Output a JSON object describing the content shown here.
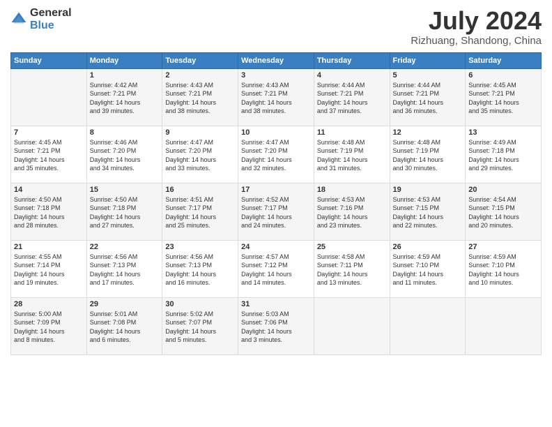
{
  "logo": {
    "general": "General",
    "blue": "Blue"
  },
  "header": {
    "title": "July 2024",
    "subtitle": "Rizhuang, Shandong, China"
  },
  "weekdays": [
    "Sunday",
    "Monday",
    "Tuesday",
    "Wednesday",
    "Thursday",
    "Friday",
    "Saturday"
  ],
  "weeks": [
    [
      {
        "date": "",
        "content": ""
      },
      {
        "date": "1",
        "content": "Sunrise: 4:42 AM\nSunset: 7:21 PM\nDaylight: 14 hours\nand 39 minutes."
      },
      {
        "date": "2",
        "content": "Sunrise: 4:43 AM\nSunset: 7:21 PM\nDaylight: 14 hours\nand 38 minutes."
      },
      {
        "date": "3",
        "content": "Sunrise: 4:43 AM\nSunset: 7:21 PM\nDaylight: 14 hours\nand 38 minutes."
      },
      {
        "date": "4",
        "content": "Sunrise: 4:44 AM\nSunset: 7:21 PM\nDaylight: 14 hours\nand 37 minutes."
      },
      {
        "date": "5",
        "content": "Sunrise: 4:44 AM\nSunset: 7:21 PM\nDaylight: 14 hours\nand 36 minutes."
      },
      {
        "date": "6",
        "content": "Sunrise: 4:45 AM\nSunset: 7:21 PM\nDaylight: 14 hours\nand 35 minutes."
      }
    ],
    [
      {
        "date": "7",
        "content": "Sunrise: 4:45 AM\nSunset: 7:21 PM\nDaylight: 14 hours\nand 35 minutes."
      },
      {
        "date": "8",
        "content": "Sunrise: 4:46 AM\nSunset: 7:20 PM\nDaylight: 14 hours\nand 34 minutes."
      },
      {
        "date": "9",
        "content": "Sunrise: 4:47 AM\nSunset: 7:20 PM\nDaylight: 14 hours\nand 33 minutes."
      },
      {
        "date": "10",
        "content": "Sunrise: 4:47 AM\nSunset: 7:20 PM\nDaylight: 14 hours\nand 32 minutes."
      },
      {
        "date": "11",
        "content": "Sunrise: 4:48 AM\nSunset: 7:19 PM\nDaylight: 14 hours\nand 31 minutes."
      },
      {
        "date": "12",
        "content": "Sunrise: 4:48 AM\nSunset: 7:19 PM\nDaylight: 14 hours\nand 30 minutes."
      },
      {
        "date": "13",
        "content": "Sunrise: 4:49 AM\nSunset: 7:18 PM\nDaylight: 14 hours\nand 29 minutes."
      }
    ],
    [
      {
        "date": "14",
        "content": "Sunrise: 4:50 AM\nSunset: 7:18 PM\nDaylight: 14 hours\nand 28 minutes."
      },
      {
        "date": "15",
        "content": "Sunrise: 4:50 AM\nSunset: 7:18 PM\nDaylight: 14 hours\nand 27 minutes."
      },
      {
        "date": "16",
        "content": "Sunrise: 4:51 AM\nSunset: 7:17 PM\nDaylight: 14 hours\nand 25 minutes."
      },
      {
        "date": "17",
        "content": "Sunrise: 4:52 AM\nSunset: 7:17 PM\nDaylight: 14 hours\nand 24 minutes."
      },
      {
        "date": "18",
        "content": "Sunrise: 4:53 AM\nSunset: 7:16 PM\nDaylight: 14 hours\nand 23 minutes."
      },
      {
        "date": "19",
        "content": "Sunrise: 4:53 AM\nSunset: 7:15 PM\nDaylight: 14 hours\nand 22 minutes."
      },
      {
        "date": "20",
        "content": "Sunrise: 4:54 AM\nSunset: 7:15 PM\nDaylight: 14 hours\nand 20 minutes."
      }
    ],
    [
      {
        "date": "21",
        "content": "Sunrise: 4:55 AM\nSunset: 7:14 PM\nDaylight: 14 hours\nand 19 minutes."
      },
      {
        "date": "22",
        "content": "Sunrise: 4:56 AM\nSunset: 7:13 PM\nDaylight: 14 hours\nand 17 minutes."
      },
      {
        "date": "23",
        "content": "Sunrise: 4:56 AM\nSunset: 7:13 PM\nDaylight: 14 hours\nand 16 minutes."
      },
      {
        "date": "24",
        "content": "Sunrise: 4:57 AM\nSunset: 7:12 PM\nDaylight: 14 hours\nand 14 minutes."
      },
      {
        "date": "25",
        "content": "Sunrise: 4:58 AM\nSunset: 7:11 PM\nDaylight: 14 hours\nand 13 minutes."
      },
      {
        "date": "26",
        "content": "Sunrise: 4:59 AM\nSunset: 7:10 PM\nDaylight: 14 hours\nand 11 minutes."
      },
      {
        "date": "27",
        "content": "Sunrise: 4:59 AM\nSunset: 7:10 PM\nDaylight: 14 hours\nand 10 minutes."
      }
    ],
    [
      {
        "date": "28",
        "content": "Sunrise: 5:00 AM\nSunset: 7:09 PM\nDaylight: 14 hours\nand 8 minutes."
      },
      {
        "date": "29",
        "content": "Sunrise: 5:01 AM\nSunset: 7:08 PM\nDaylight: 14 hours\nand 6 minutes."
      },
      {
        "date": "30",
        "content": "Sunrise: 5:02 AM\nSunset: 7:07 PM\nDaylight: 14 hours\nand 5 minutes."
      },
      {
        "date": "31",
        "content": "Sunrise: 5:03 AM\nSunset: 7:06 PM\nDaylight: 14 hours\nand 3 minutes."
      },
      {
        "date": "",
        "content": ""
      },
      {
        "date": "",
        "content": ""
      },
      {
        "date": "",
        "content": ""
      }
    ]
  ]
}
